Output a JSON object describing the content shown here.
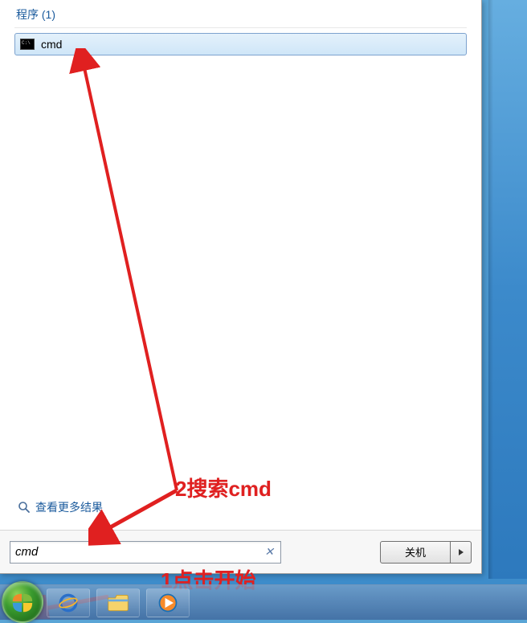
{
  "section_header": "程序 (1)",
  "result": {
    "label": "cmd"
  },
  "see_more_label": "查看更多结果",
  "search_value": "cmd",
  "shutdown_label": "关机",
  "annotations": {
    "step1": "1点击开始",
    "step2": "2搜索cmd"
  }
}
